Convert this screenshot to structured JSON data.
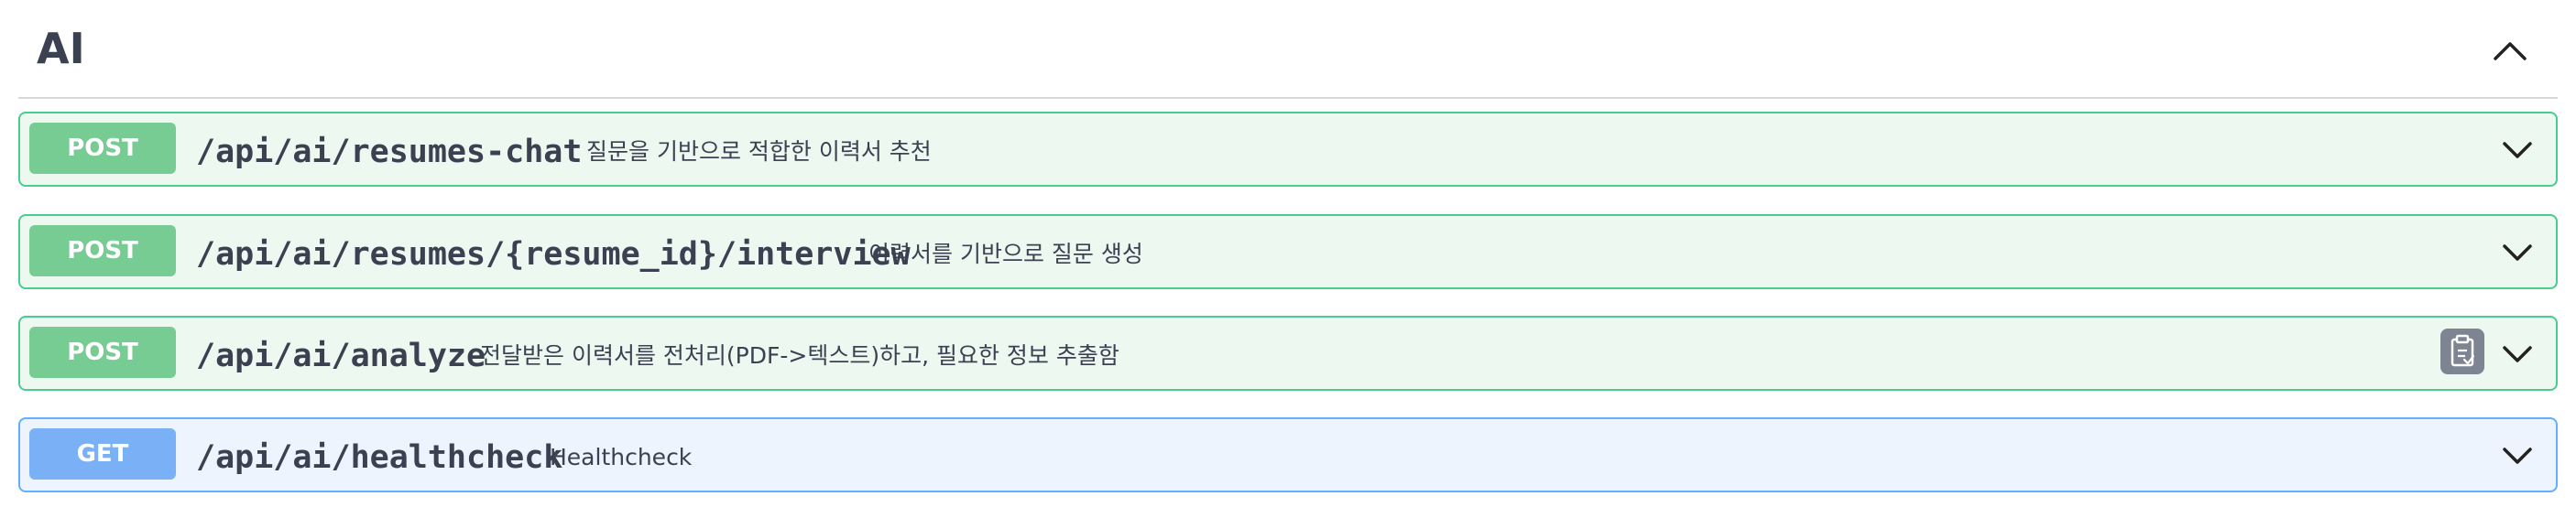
{
  "section": {
    "title": "AI",
    "collapse_icon": "chevron-up-icon"
  },
  "operations": [
    {
      "method": "POST",
      "path": "/api/ai/resumes-chat",
      "summary": "질문을 기반으로 적합한 이력서 추천",
      "expand_icon": "chevron-down-icon"
    },
    {
      "method": "POST",
      "path": "/api/ai/resumes/{resume_id}/interview",
      "summary": "이력서를 기반으로 질문 생성",
      "expand_icon": "chevron-down-icon"
    },
    {
      "method": "POST",
      "path": "/api/ai/analyze",
      "summary": "전달받은 이력서를 전처리(PDF->텍스트)하고, 필요한 정보 추출함",
      "copy_icon": "clipboard-icon",
      "expand_icon": "chevron-down-icon"
    },
    {
      "method": "GET",
      "path": "/api/ai/healthcheck",
      "summary": "Healthcheck",
      "expand_icon": "chevron-down-icon"
    }
  ],
  "colors": {
    "post_accent": "#49cc90",
    "post_background": "#edf8f1",
    "post_badge": "#76cc93",
    "get_accent": "#61affe",
    "get_background": "#eef4fd",
    "get_badge": "#7ab1f6",
    "text": "#3b4151"
  }
}
